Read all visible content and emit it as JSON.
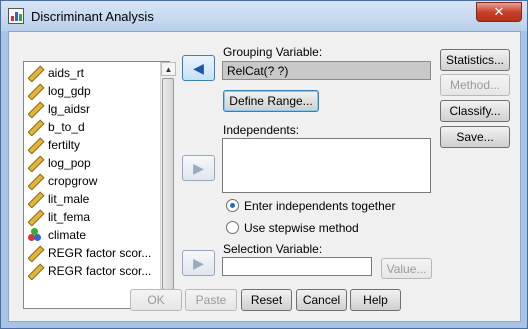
{
  "window": {
    "title": "Discriminant Analysis",
    "close_label": "✕"
  },
  "variables": [
    {
      "label": "aids_rt",
      "icon": "ruler-scale-icon"
    },
    {
      "label": "log_gdp",
      "icon": "ruler-scale-icon"
    },
    {
      "label": "lg_aidsr",
      "icon": "ruler-scale-icon"
    },
    {
      "label": "b_to_d",
      "icon": "ruler-scale-icon"
    },
    {
      "label": "fertilty",
      "icon": "ruler-scale-icon"
    },
    {
      "label": "log_pop",
      "icon": "ruler-scale-icon"
    },
    {
      "label": "cropgrow",
      "icon": "ruler-scale-icon"
    },
    {
      "label": "lit_male",
      "icon": "ruler-scale-icon"
    },
    {
      "label": "lit_fema",
      "icon": "ruler-scale-icon"
    },
    {
      "label": "climate",
      "icon": "nominal-balls-icon"
    },
    {
      "label": "REGR factor scor...",
      "icon": "ruler-scale-icon"
    },
    {
      "label": "REGR factor scor...",
      "icon": "ruler-scale-icon"
    }
  ],
  "grouping": {
    "label": "Grouping Variable:",
    "value": "RelCat(? ?)",
    "define_range": "Define Range..."
  },
  "independents": {
    "label": "Independents:",
    "options": [
      {
        "label": "Enter independents together",
        "selected": true
      },
      {
        "label": "Use stepwise method",
        "selected": false
      }
    ]
  },
  "selection": {
    "label": "Selection Variable:",
    "value": "",
    "value_button": "Value..."
  },
  "side_buttons": [
    "Statistics...",
    "Method...",
    "Classify...",
    "Save..."
  ],
  "bottom_buttons": [
    "OK",
    "Paste",
    "Reset",
    "Cancel",
    "Help"
  ],
  "colors": {
    "accent": "#1f56a8",
    "titlebar": "#b9cfea",
    "close": "#c8412b"
  }
}
